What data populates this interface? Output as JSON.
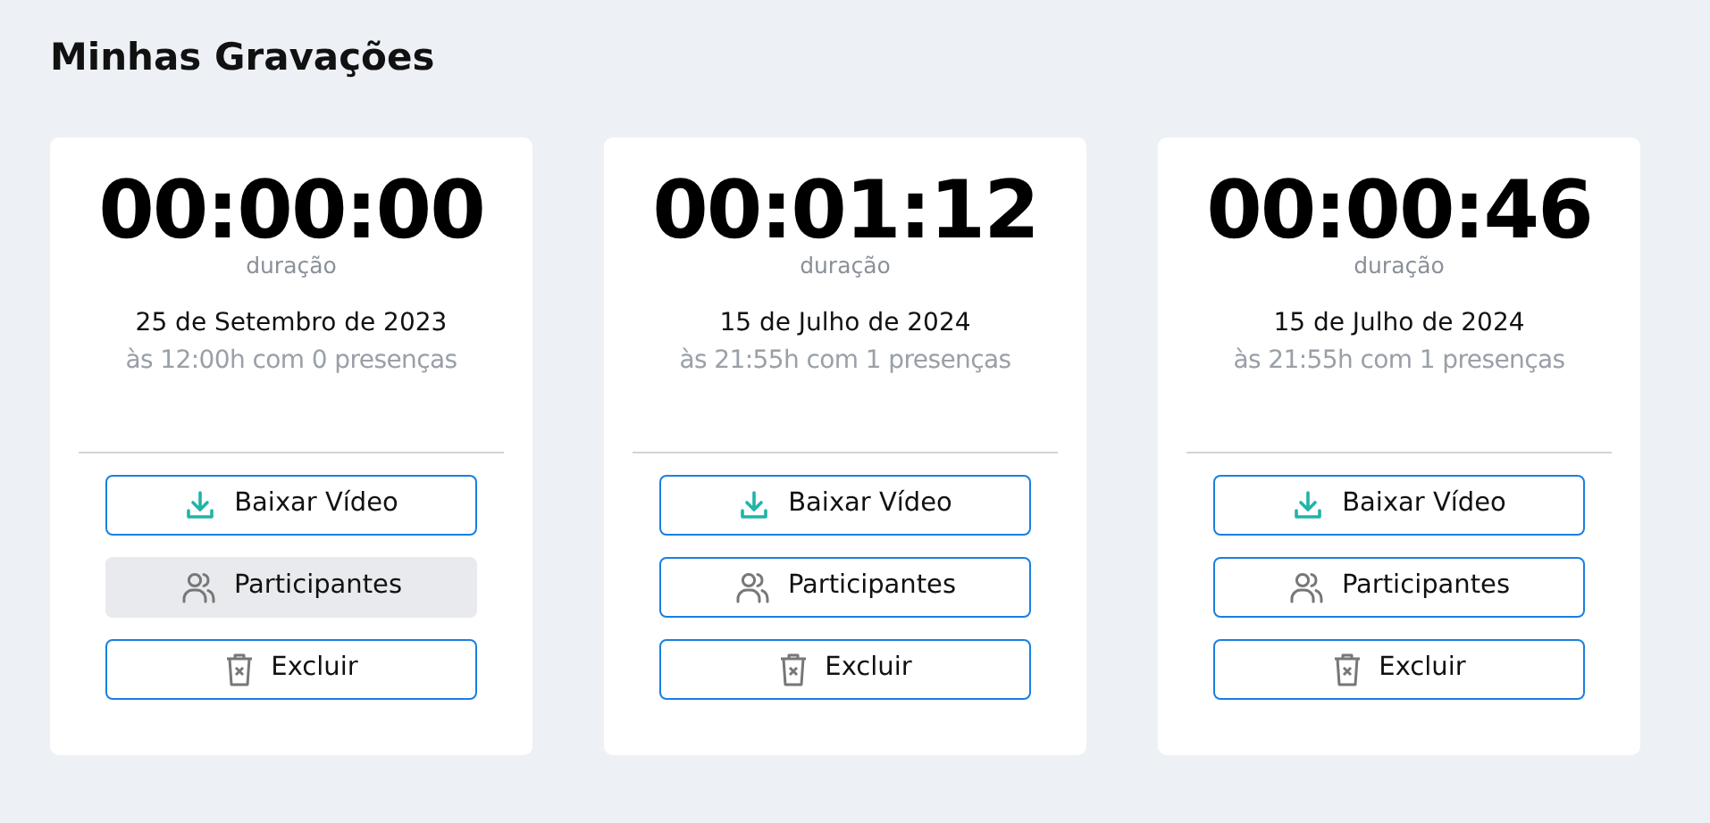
{
  "title": "Minhas Gravações",
  "recordings": [
    {
      "duration": "00:00:00",
      "duration_label": "duração",
      "date": "25 de Setembro de 2023",
      "details": "às 12:00h com 0 presenças",
      "buttons": [
        {
          "kind": "download",
          "label": "Baixar Vídeo",
          "hovered": false
        },
        {
          "kind": "participants",
          "label": "Participantes",
          "hovered": true
        },
        {
          "kind": "delete",
          "label": "Excluir",
          "hovered": false
        }
      ]
    },
    {
      "duration": "00:01:12",
      "duration_label": "duração",
      "date": "15 de Julho de 2024",
      "details": "às 21:55h com 1 presenças",
      "buttons": [
        {
          "kind": "download",
          "label": "Baixar Vídeo",
          "hovered": false
        },
        {
          "kind": "participants",
          "label": "Participantes",
          "hovered": false
        },
        {
          "kind": "delete",
          "label": "Excluir",
          "hovered": false
        }
      ]
    },
    {
      "duration": "00:00:46",
      "duration_label": "duração",
      "date": "15 de Julho de 2024",
      "details": "às 21:55h com 1 presenças",
      "buttons": [
        {
          "kind": "download",
          "label": "Baixar Vídeo",
          "hovered": false
        },
        {
          "kind": "participants",
          "label": "Participantes",
          "hovered": false
        },
        {
          "kind": "delete",
          "label": "Excluir",
          "hovered": false
        }
      ]
    }
  ]
}
